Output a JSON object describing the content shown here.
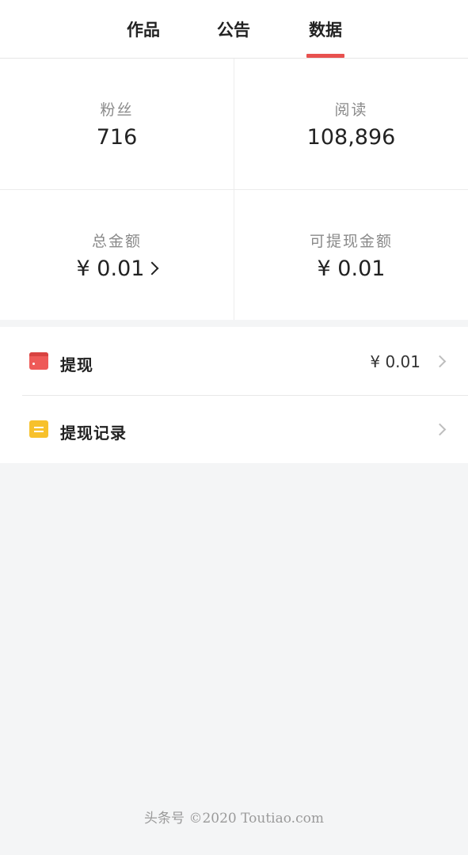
{
  "tabs": [
    {
      "label": "作品",
      "active": false
    },
    {
      "label": "公告",
      "active": false
    },
    {
      "label": "数据",
      "active": true
    }
  ],
  "colors": {
    "accent": "#e8514f",
    "wallet_icon": "#ee5a58",
    "record_icon": "#f7c12c",
    "background": "#f4f5f6"
  },
  "stats": [
    {
      "label": "粉丝",
      "value": "716"
    },
    {
      "label": "阅读",
      "value": "108,896"
    },
    {
      "label": "总金额",
      "value": "¥ 0.01"
    },
    {
      "label": "可提现金额",
      "value": "¥ 0.01"
    }
  ],
  "list": [
    {
      "icon": "wallet-icon",
      "label": "提现",
      "value": "¥ 0.01"
    },
    {
      "icon": "record-icon",
      "label": "提现记录",
      "value": ""
    }
  ],
  "footer": {
    "text": "头条号 ©2020 Toutiao.com"
  }
}
